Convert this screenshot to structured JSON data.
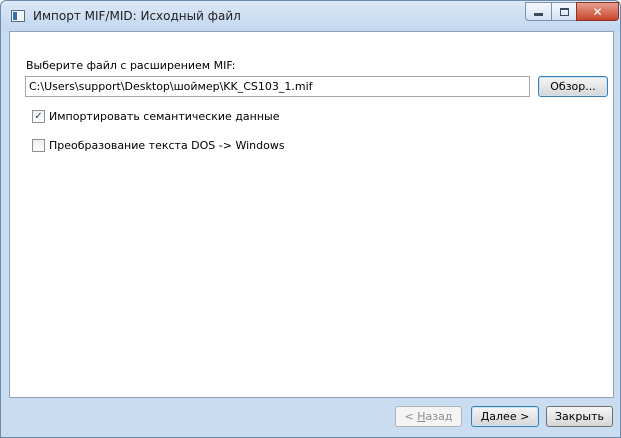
{
  "window": {
    "title": "Импорт MIF/MID: Исходный файл",
    "controls": {
      "minimize": "",
      "maximize": "",
      "close": "✕"
    }
  },
  "form": {
    "file_label": "Выберите файл с расширением MIF:",
    "file_path": "C:\\Users\\support\\Desktop\\шоймер\\KK_CS103_1.mif",
    "browse_button": "Обзор...",
    "checkboxes": [
      {
        "label": "Импортировать семантические данные",
        "checked": true,
        "mark": "✓"
      },
      {
        "label": "Преобразование текста DOS -> Windows",
        "checked": false,
        "mark": ""
      }
    ]
  },
  "footer": {
    "back_prefix": "< ",
    "back_accel": "Н",
    "back_rest": "азад",
    "back_enabled": false,
    "next_accel": "Д",
    "next_rest": "алее >",
    "close_label": "Закрыть"
  },
  "colors": {
    "frame": "#c9dcf0",
    "close_button": "#c6442a",
    "focus_border": "#3c7fb1"
  },
  "icons": {
    "app": "window-app-icon",
    "minimize": "minimize-icon",
    "maximize": "maximize-icon",
    "close": "close-icon",
    "check": "checkmark-icon"
  }
}
